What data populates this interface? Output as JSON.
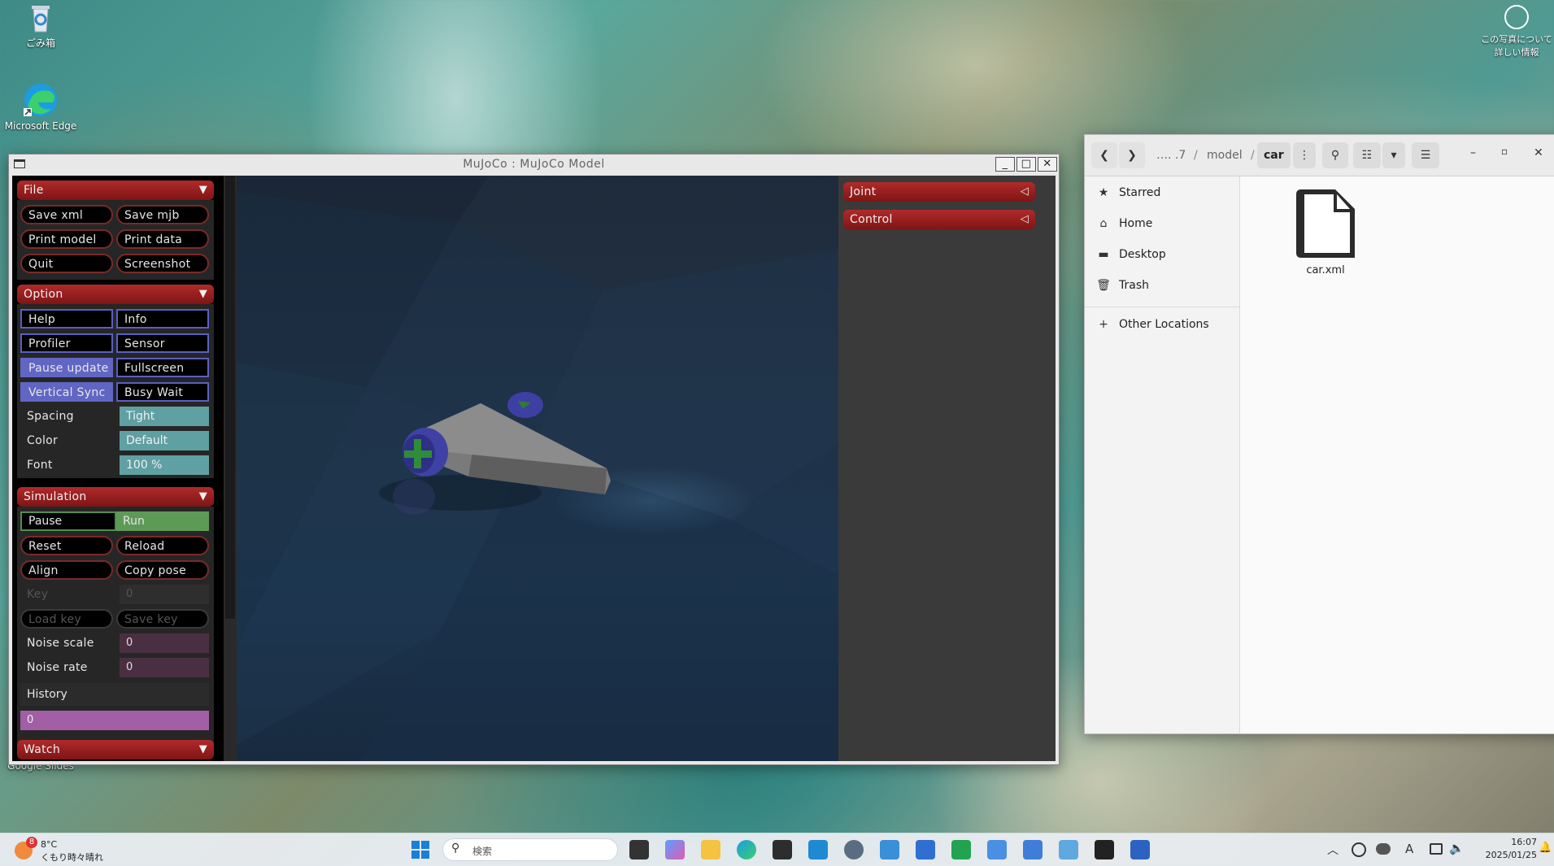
{
  "desktop": {
    "icons": [
      {
        "label": "ごみ箱"
      },
      {
        "label": "Microsoft Edge"
      },
      {
        "label": "Google Slides"
      }
    ],
    "photo_info": {
      "line1": "この写真について",
      "line2": "詳しい情報"
    }
  },
  "mujoco": {
    "window_title": "MuJoCo : MuJoCo Model",
    "file": {
      "header": "File",
      "buttons": [
        "Save xml",
        "Save mjb",
        "Print model",
        "Print data",
        "Quit",
        "Screenshot"
      ]
    },
    "option": {
      "header": "Option",
      "buttons": [
        "Help",
        "Info",
        "Profiler",
        "Sensor",
        "Pause update",
        "Fullscreen",
        "Vertical Sync",
        "Busy Wait"
      ],
      "spacing_label": "Spacing",
      "spacing_value": "Tight",
      "color_label": "Color",
      "color_value": "Default",
      "font_label": "Font",
      "font_value": "100 %"
    },
    "simulation": {
      "header": "Simulation",
      "pause_label": "Pause",
      "run_label": "Run",
      "reset_label": "Reset",
      "reload_label": "Reload",
      "align_label": "Align",
      "copy_pose_label": "Copy pose",
      "key_label": "Key",
      "key_value": "0",
      "load_key_label": "Load key",
      "save_key_label": "Save key",
      "noise_scale_label": "Noise scale",
      "noise_scale_value": "0",
      "noise_rate_label": "Noise rate",
      "noise_rate_value": "0",
      "history_label": "History",
      "history_value": "0"
    },
    "watch": {
      "header": "Watch"
    },
    "right_panel": {
      "joint_header": "Joint",
      "control_header": "Control"
    }
  },
  "file_manager": {
    "breadcrumbs": [
      "…. .7",
      "model",
      "car"
    ],
    "sidebar": [
      {
        "label": "Starred",
        "icon": "star-icon"
      },
      {
        "label": "Home",
        "icon": "home-icon"
      },
      {
        "label": "Desktop",
        "icon": "folder-icon"
      },
      {
        "label": "Trash",
        "icon": "trash-icon"
      },
      {
        "label": "Other Locations",
        "icon": "plus-icon"
      }
    ],
    "files": [
      {
        "name": "car.xml"
      }
    ]
  },
  "taskbar": {
    "weather_temp": "8°C",
    "weather_desc": "くもり時々晴れ",
    "weather_badge": "8",
    "search_placeholder": "検索",
    "time": "16:07",
    "date": "2025/01/25",
    "ime": "A"
  }
}
